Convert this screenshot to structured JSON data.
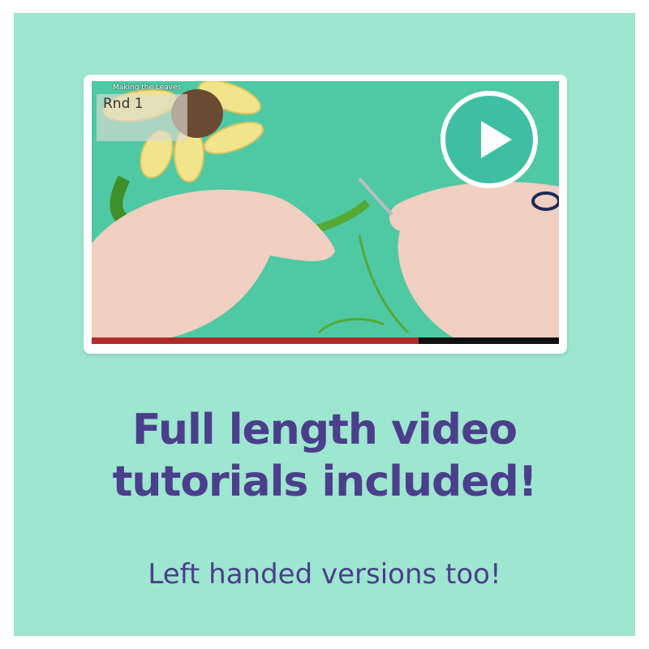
{
  "video": {
    "scene_title": "Making the Leaves",
    "round_label": "Rnd 1",
    "progress_fraction": 0.7
  },
  "headline": {
    "line1": "Full length video",
    "line2": "tutorials included!"
  },
  "subline": "Left handed versions too!",
  "colors": {
    "background": "#9de6cf",
    "text": "#4b3e8c",
    "play_button": "#3fbfa2",
    "progress": "#b02a2a"
  }
}
